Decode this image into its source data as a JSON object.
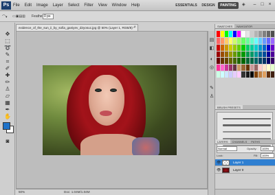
{
  "app": {
    "logo": "Ps"
  },
  "menu": [
    "File",
    "Edit",
    "Image",
    "Layer",
    "Select",
    "Filter",
    "View",
    "Window",
    "Help"
  ],
  "workspaces": {
    "essentials": "ESSENTIALS",
    "design": "DESIGN",
    "painting": "PAINTING"
  },
  "window_controls": {
    "minimize": "–",
    "restore": "□",
    "close": "×"
  },
  "options": {
    "feather_label": "Feather:",
    "feather_value": "0 px"
  },
  "document": {
    "tab_title": "evidence_of_the_sun_ii_by_sofia_ganiyev_d2yosuc.jpg @ 50% (Layer 1, RGB/8) *",
    "close": "×"
  },
  "status": {
    "zoom": "50%",
    "doc": "Doc: 1.04M/1.04M"
  },
  "colors": {
    "foreground": "#1f72c8",
    "background": "#ffffff",
    "selection": "#2f7fd1"
  },
  "panels": {
    "swatches_tabs": [
      "SWATCHES",
      "NAVIGATOR"
    ],
    "brush_tabs": [
      "BRUSH PRESETS"
    ],
    "layers_tabs": [
      "LAYERS",
      "CHANNELS",
      "PATHS"
    ],
    "blend_mode": "Normal",
    "opacity_label": "Opacity:",
    "opacity_value": "100%",
    "lock_label": "Lock:",
    "fill_label": "Fill:",
    "fill_value": "100%",
    "layers": [
      {
        "name": "Layer 1",
        "selected": true
      },
      {
        "name": "Layer 0",
        "selected": false
      }
    ]
  },
  "swatch_colors": [
    "#ff0000",
    "#ffff00",
    "#00ff00",
    "#00ffff",
    "#0000ff",
    "#ff00ff",
    "#ffffff",
    "#e6e6e6",
    "#cccccc",
    "#b3b3b3",
    "#999999",
    "#808080",
    "#666666",
    "#4d4d4d",
    "#ff6666",
    "#ff9966",
    "#ffcc66",
    "#ffff66",
    "#ccff66",
    "#99ff66",
    "#66ff66",
    "#66ff99",
    "#66ffcc",
    "#66ffff",
    "#66ccff",
    "#6699ff",
    "#6666ff",
    "#9966ff",
    "#cc0000",
    "#cc6600",
    "#cc9900",
    "#cccc00",
    "#99cc00",
    "#66cc00",
    "#00cc00",
    "#00cc66",
    "#00cc99",
    "#00cccc",
    "#0099cc",
    "#0066cc",
    "#0000cc",
    "#6600cc",
    "#990000",
    "#994c00",
    "#996600",
    "#999900",
    "#669900",
    "#339900",
    "#009900",
    "#00994c",
    "#009966",
    "#009999",
    "#006699",
    "#004c99",
    "#000099",
    "#4c0099",
    "#660000",
    "#663300",
    "#664400",
    "#666600",
    "#446600",
    "#226600",
    "#006600",
    "#006633",
    "#006644",
    "#006666",
    "#004466",
    "#003366",
    "#000066",
    "#330066",
    "#ff3399",
    "#ff66cc",
    "#cc3399",
    "#993366",
    "#663344",
    "#cc9966",
    "#996633",
    "#663300",
    "#cc9999",
    "#996666",
    "#ffcccc",
    "#ffe6cc",
    "#ffffcc",
    "#e6ffcc",
    "#ccffe6",
    "#ccffff",
    "#cce6ff",
    "#ccccff",
    "#e6ccff",
    "#ffccff",
    "#333333",
    "#1a1a1a",
    "#000000",
    "#804000",
    "#c08040",
    "#e0a060",
    "#603010",
    "#402010"
  ]
}
